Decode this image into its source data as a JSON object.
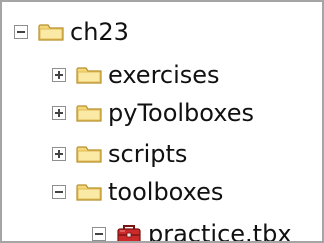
{
  "tree": {
    "root": {
      "label": "ch23",
      "state": "expanded",
      "icon": "folder-icon"
    },
    "children": [
      {
        "label": "exercises",
        "state": "collapsed",
        "icon": "folder-icon"
      },
      {
        "label": "pyToolboxes",
        "state": "collapsed",
        "icon": "folder-icon"
      },
      {
        "label": "scripts",
        "state": "collapsed",
        "icon": "folder-icon"
      },
      {
        "label": "toolboxes",
        "state": "expanded",
        "icon": "folder-icon",
        "children": [
          {
            "label": "practice.tbx",
            "state": "expanded",
            "icon": "toolbox-icon"
          }
        ]
      }
    ]
  },
  "colors": {
    "folder_fill": "#f4d77a",
    "folder_tab": "#e9c35a",
    "folder_outline": "#b8902e",
    "toolbox_red": "#cc2a2a",
    "expander_border": "#8e8f8f",
    "frame_border": "#a5a5a5"
  }
}
